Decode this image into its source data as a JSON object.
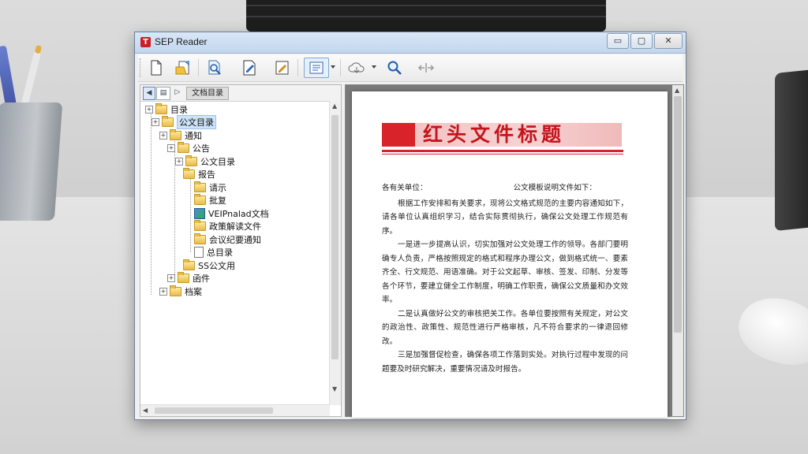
{
  "window": {
    "title": "SEP Reader",
    "controls": {
      "minimize": "▭",
      "maximize": "▢",
      "close": "✕"
    }
  },
  "toolbar": {
    "buttons": [
      {
        "name": "new-document-icon"
      },
      {
        "name": "open-folder-icon"
      },
      {
        "name": "search-document-icon"
      },
      {
        "name": "edit-document-icon"
      },
      {
        "name": "annotate-icon"
      },
      {
        "name": "view-list-icon"
      },
      {
        "name": "cloud-sync-icon"
      },
      {
        "name": "zoom-icon"
      },
      {
        "name": "fit-width-icon"
      }
    ]
  },
  "left_pane": {
    "tab_label": "文档目录",
    "nav_back": "◀",
    "nav_mid": "▤",
    "nav_forward": "▷",
    "tree": [
      {
        "label": "目录",
        "level": 0,
        "type": "folder",
        "exp": "+"
      },
      {
        "label": "公文目录",
        "level": 1,
        "type": "folder",
        "exp": "+",
        "selected": true
      },
      {
        "label": "通知",
        "level": 2,
        "type": "folder",
        "exp": "+"
      },
      {
        "label": "公告",
        "level": 3,
        "type": "folder",
        "exp": "+"
      },
      {
        "label": "公文目录",
        "level": 4,
        "type": "folder",
        "exp": "+"
      },
      {
        "label": "报告",
        "level": 5,
        "type": "folder",
        "exp": ""
      },
      {
        "label": "请示",
        "level": 6,
        "type": "folder",
        "exp": ""
      },
      {
        "label": "批复",
        "level": 6,
        "type": "folder",
        "exp": ""
      },
      {
        "label": "VEIPnalad文档",
        "level": 6,
        "type": "special",
        "exp": ""
      },
      {
        "label": "政策解读文件",
        "level": 6,
        "type": "folder",
        "exp": ""
      },
      {
        "label": "会议纪要通知",
        "level": 6,
        "type": "folder",
        "exp": ""
      },
      {
        "label": "总目录",
        "level": 6,
        "type": "doc",
        "exp": ""
      },
      {
        "label": "SS公文用",
        "level": 5,
        "type": "folder",
        "exp": ""
      },
      {
        "label": "函件",
        "level": 3,
        "type": "folder",
        "exp": "+"
      },
      {
        "label": "档案",
        "level": 2,
        "type": "folder",
        "exp": "+"
      }
    ]
  },
  "document": {
    "title": "红头文件标题",
    "greeting_left": "各有关单位：",
    "greeting_right": "公文模板说明文件如下：",
    "paragraphs": [
      "根据工作安排和有关要求，现将公文格式规范的主要内容通知如下，请各单位认真组织学习，结合实际贯彻执行，确保公文处理工作规范有序。",
      "一是进一步提高认识，切实加强对公文处理工作的领导。各部门要明确专人负责，严格按照规定的格式和程序办理公文，做到格式统一、要素齐全、行文规范、用语准确。对于公文起草、审核、签发、印制、分发等各个环节，要建立健全工作制度，明确工作职责，确保公文质量和办文效率。",
      "二是认真做好公文的审核把关工作。各单位要按照有关规定，对公文的政治性、政策性、规范性进行严格审核，凡不符合要求的一律退回修改。",
      "三是加强督促检查，确保各项工作落到实处。对执行过程中发现的问题要及时研究解决，重要情况请及时报告。"
    ]
  }
}
